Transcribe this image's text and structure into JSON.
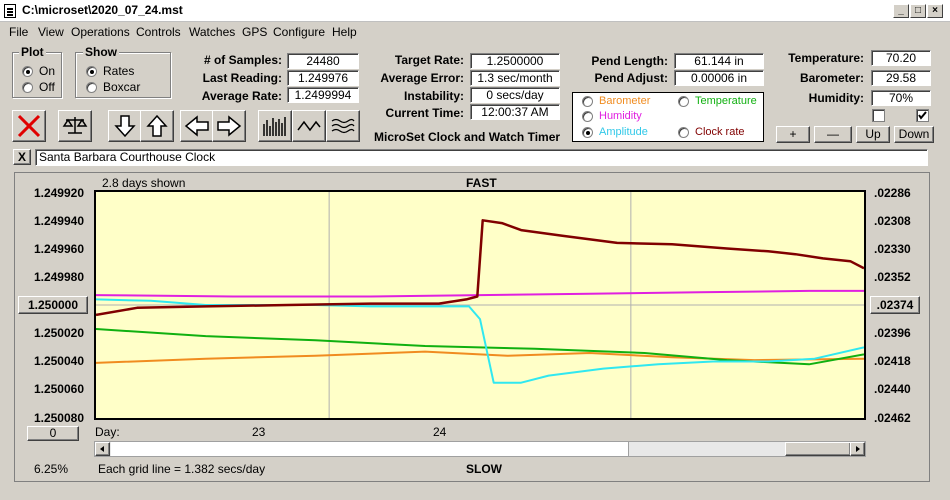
{
  "window": {
    "title": "C:\\microset\\2020_07_24.mst"
  },
  "menu": [
    "File",
    "View",
    "Operations",
    "Controls",
    "Watches",
    "GPS",
    "Configure",
    "Help"
  ],
  "plot_group": {
    "title": "Plot",
    "on": "On",
    "off": "Off",
    "selected": "On"
  },
  "show_group": {
    "title": "Show",
    "rates": "Rates",
    "boxcar": "Boxcar",
    "selected": "Rates"
  },
  "stats": {
    "samples_label": "# of Samples:",
    "samples": "24480",
    "last_label": "Last Reading:",
    "last": "1.249976",
    "avg_rate_label": "Average Rate:",
    "avg_rate": "1.2499994",
    "target_label": "Target Rate:",
    "target": "1.2500000",
    "avg_err_label": "Average Error:",
    "avg_err": "1.3 sec/month",
    "instab_label": "Instability:",
    "instab": "0 secs/day",
    "time_label": "Current Time:",
    "time": "12:00:37 AM",
    "app_caption": "MicroSet Clock and Watch Timer",
    "pend_len_label": "Pend Length:",
    "pend_len": "61.144 in",
    "pend_adj_label": "Pend Adjust:",
    "pend_adj": "0.00006 in",
    "temp_label": "Temperature:",
    "temp": "70.20",
    "baro_label": "Barometer:",
    "baro": "29.58",
    "hum_label": "Humidity:",
    "hum": "70%"
  },
  "series_options": {
    "barometer": "Barometer",
    "temperature": "Temperature",
    "humidity": "Humidity",
    "amplitude": "Amplitude",
    "clock_rate": "Clock rate",
    "selected": "Amplitude"
  },
  "step_buttons": {
    "plus": "+",
    "minus": "—",
    "up": "Up",
    "down": "Down"
  },
  "clock_name": "Santa Barbara Courthouse Clock",
  "close_x": "X",
  "chart_header": {
    "days_shown": "2.8 days shown",
    "fast": "FAST",
    "slow": "SLOW",
    "grid_note": "Each grid line = 1.382 secs/day",
    "day_label": "Day:",
    "percent": "6.25%",
    "left_button": "1.250000",
    "right_button": ".02374",
    "bottom_button": "0"
  },
  "colors": {
    "rate": "#800000",
    "humidity": "#e020e0",
    "amplitude": "#30e8f0",
    "temperature": "#10b010",
    "barometer": "#f08c20",
    "plot_bg": "#ffffc8"
  },
  "chart_data": {
    "type": "line",
    "title": "",
    "xlabel": "Day:",
    "x_ticks": [
      "23",
      "24"
    ],
    "x_range_days": [
      0,
      2.8
    ],
    "y_left_ticks": [
      "1.249920",
      "1.249940",
      "1.249960",
      "1.249980",
      "1.250000",
      "1.250020",
      "1.250040",
      "1.250060",
      "1.250080"
    ],
    "y_right_ticks": [
      ".02286",
      ".02308",
      ".02330",
      ".02352",
      ".02374",
      ".02396",
      ".02418",
      ".02440",
      ".02462"
    ],
    "ylim_left": [
      1.25008,
      1.24992
    ],
    "series": [
      {
        "name": "Clock rate",
        "color": "#800000",
        "points": [
          [
            0,
            1.250007
          ],
          [
            0.15,
            1.250002
          ],
          [
            0.4,
            1.250001
          ],
          [
            0.7,
            1.25
          ],
          [
            1.0,
            1.249999
          ],
          [
            1.25,
            1.249999
          ],
          [
            1.35,
            1.249996
          ],
          [
            1.39,
            1.249994
          ],
          [
            1.41,
            1.24994
          ],
          [
            1.48,
            1.249942
          ],
          [
            1.55,
            1.249947
          ],
          [
            1.7,
            1.249951
          ],
          [
            1.9,
            1.249956
          ],
          [
            2.1,
            1.249957
          ],
          [
            2.3,
            1.24996
          ],
          [
            2.45,
            1.249962
          ],
          [
            2.55,
            1.249964
          ],
          [
            2.65,
            1.249967
          ],
          [
            2.75,
            1.249969
          ],
          [
            2.8,
            1.249974
          ]
        ]
      },
      {
        "name": "Amplitude",
        "color": "#30e8f0",
        "points": [
          [
            0,
            1.249996
          ],
          [
            0.2,
            1.249997
          ],
          [
            0.4,
            1.25
          ],
          [
            0.6,
            1.25
          ],
          [
            0.8,
            1.25
          ],
          [
            1.0,
            1.250001
          ],
          [
            1.2,
            1.250001
          ],
          [
            1.36,
            1.250001
          ],
          [
            1.4,
            1.25001
          ],
          [
            1.45,
            1.250055
          ],
          [
            1.55,
            1.250055
          ],
          [
            1.65,
            1.25005
          ],
          [
            1.85,
            1.250045
          ],
          [
            2.05,
            1.250042
          ],
          [
            2.25,
            1.25004
          ],
          [
            2.45,
            1.25004
          ],
          [
            2.62,
            1.250038
          ],
          [
            2.8,
            1.25003
          ]
        ]
      },
      {
        "name": "Humidity",
        "color": "#e020e0",
        "points": [
          [
            0,
            1.249993
          ],
          [
            0.5,
            1.249994
          ],
          [
            1.0,
            1.249994
          ],
          [
            1.4,
            1.249993
          ],
          [
            1.8,
            1.249992
          ],
          [
            2.2,
            1.249991
          ],
          [
            2.6,
            1.24999
          ],
          [
            2.8,
            1.24999
          ]
        ]
      },
      {
        "name": "Temperature",
        "color": "#10b010",
        "points": [
          [
            0,
            1.250017
          ],
          [
            0.4,
            1.250022
          ],
          [
            0.8,
            1.250025
          ],
          [
            1.2,
            1.250029
          ],
          [
            1.6,
            1.250031
          ],
          [
            2.0,
            1.250034
          ],
          [
            2.3,
            1.250039
          ],
          [
            2.6,
            1.250042
          ],
          [
            2.8,
            1.250035
          ]
        ]
      },
      {
        "name": "Barometer",
        "color": "#f08c20",
        "points": [
          [
            0,
            1.250041
          ],
          [
            0.4,
            1.250038
          ],
          [
            0.8,
            1.250036
          ],
          [
            1.2,
            1.250033
          ],
          [
            1.5,
            1.250036
          ],
          [
            1.8,
            1.250034
          ],
          [
            2.1,
            1.250037
          ],
          [
            2.4,
            1.250039
          ],
          [
            2.8,
            1.250038
          ]
        ]
      }
    ]
  }
}
